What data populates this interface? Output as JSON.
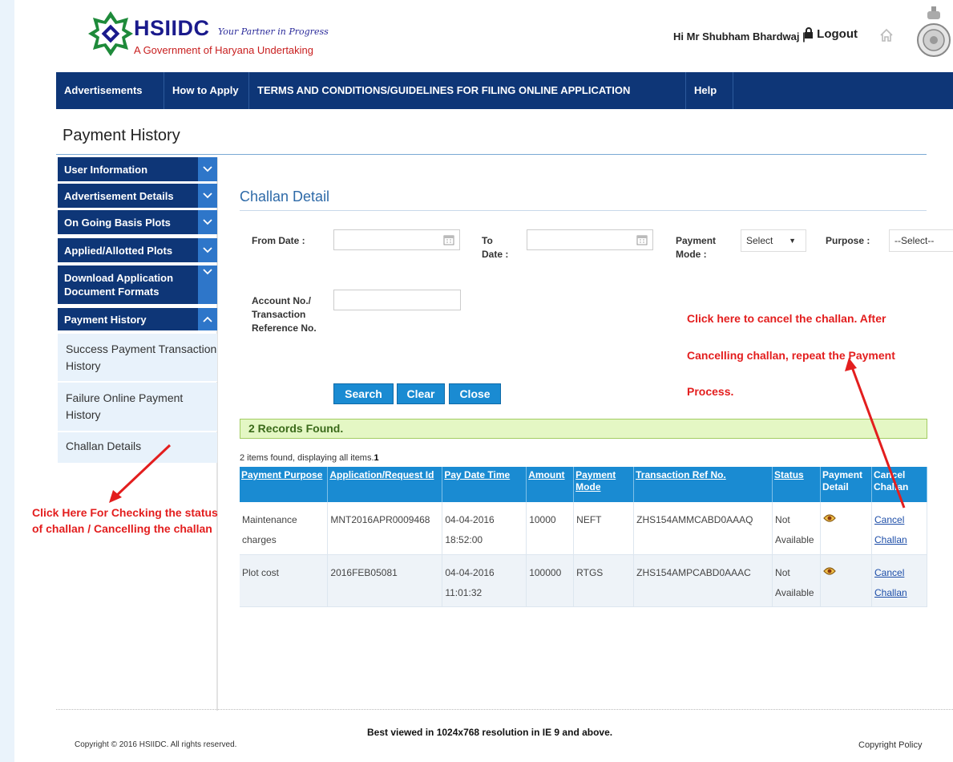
{
  "header": {
    "logo_text": "HSIIDC",
    "tagline": "Your Partner in Progress",
    "subline": "A Government of Haryana Undertaking",
    "greeting": "Hi Mr Shubham Bhardwaj |",
    "logout_label": "Logout"
  },
  "nav": {
    "items": [
      {
        "label": "Advertisements"
      },
      {
        "label": "How to Apply"
      },
      {
        "label": "TERMS AND CONDITIONS/GUIDELINES FOR FILING ONLINE APPLICATION"
      },
      {
        "label": "Help"
      }
    ]
  },
  "page_title": "Payment History",
  "sidebar": {
    "items": [
      {
        "label": "User Information"
      },
      {
        "label": "Advertisement Details"
      },
      {
        "label": "On Going Basis Plots"
      },
      {
        "label": "Applied/Allotted Plots"
      },
      {
        "label": "Download Application Document Formats"
      },
      {
        "label": "Payment History"
      }
    ],
    "sub_items": [
      {
        "label": "Success Payment Transaction History"
      },
      {
        "label": "Failure Online Payment History"
      },
      {
        "label": "Challan Details"
      }
    ]
  },
  "main": {
    "section_title": "Challan Detail",
    "filters": {
      "from_date_label": "From Date :",
      "to_date_label": "To Date :",
      "payment_mode_label": "Payment Mode :",
      "payment_mode_value": "Select",
      "purpose_label": "Purpose :",
      "purpose_value": "--Select--",
      "account_label": "Account No./ Transaction Reference No."
    },
    "buttons": {
      "search": "Search",
      "clear": "Clear",
      "close": "Close"
    },
    "records_found": "2 Records Found.",
    "items_found_text": "2 items found, displaying all items.",
    "items_found_page": "1",
    "table": {
      "headers": [
        "Payment Purpose",
        "Application/Request Id",
        "Pay Date Time",
        "Amount",
        "Payment Mode",
        "Transaction Ref No.",
        "Status",
        "Payment Detail",
        "Cancel Challan"
      ],
      "rows": [
        {
          "purpose": "Maintenance charges",
          "app_id": "MNT2016APR0009468",
          "pay_date": "04-04-2016 18:52:00",
          "amount": "10000",
          "mode": "NEFT",
          "txn_ref": "ZHS154AMMCABD0AAAQ",
          "status": "Not Available",
          "cancel": "Cancel Challan"
        },
        {
          "purpose": "Plot cost",
          "app_id": "2016FEB05081",
          "pay_date": "04-04-2016 11:01:32",
          "amount": "100000",
          "mode": "RTGS",
          "txn_ref": "ZHS154AMPCABD0AAAC",
          "status": "Not Available",
          "cancel": "Cancel Challan"
        }
      ]
    }
  },
  "annotations": {
    "left_note": "Click Here For Checking the status of challan / Cancelling the challan",
    "right_line1": "Click here to cancel the challan. After",
    "right_line2": "Cancelling challan, repeat the Payment",
    "right_line3": "Process."
  },
  "footer": {
    "best_viewed": "Best viewed in 1024x768 resolution in IE 9 and above.",
    "copyright": "Copyright © 2016 HSIIDC. All rights reserved.",
    "copyright_policy": "Copyright Policy"
  },
  "colors": {
    "nav_bg": "#0e3677",
    "accent": "#1a8bd2",
    "annotation": "#e31e1e",
    "records_bg": "#e4f7c4"
  }
}
